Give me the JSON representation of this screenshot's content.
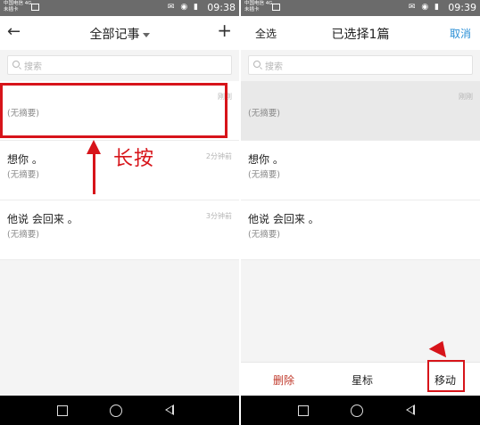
{
  "status": {
    "carrier_line1": "中国电信 4G",
    "carrier_line2": "未插卡",
    "icons": "✉ ◉ ▮",
    "time_left": "09:38",
    "time_right": "09:39"
  },
  "left": {
    "title": "全部记事",
    "search_placeholder": "搜索",
    "notes": [
      {
        "title": "",
        "subtitle": "(无摘要)",
        "time": "刚刚"
      },
      {
        "title": "想你 。",
        "subtitle": "(无摘要)",
        "time": "2分钟前"
      },
      {
        "title": "他说 会回来 。",
        "subtitle": "(无摘要)",
        "time": "3分钟前"
      }
    ],
    "annotation": "长按"
  },
  "right": {
    "select_all": "全选",
    "title": "已选择1篇",
    "cancel": "取消",
    "search_placeholder": "搜索",
    "notes": [
      {
        "title": "",
        "subtitle": "(无摘要)",
        "time": "刚刚"
      },
      {
        "title": "想你 。",
        "subtitle": "(无摘要)",
        "time": ""
      },
      {
        "title": "他说 会回来 。",
        "subtitle": "(无摘要)",
        "time": ""
      }
    ],
    "actions": {
      "delete": "删除",
      "star": "星标",
      "move": "移动"
    }
  },
  "colors": {
    "accent_red": "#d7141a",
    "link_blue": "#2a8fd6",
    "delete_red": "#c0392b"
  },
  "icons": [
    "back-arrow-icon",
    "plus-icon",
    "search-icon",
    "caret-down-icon",
    "nav-square-icon",
    "nav-circle-icon",
    "nav-back-icon"
  ]
}
